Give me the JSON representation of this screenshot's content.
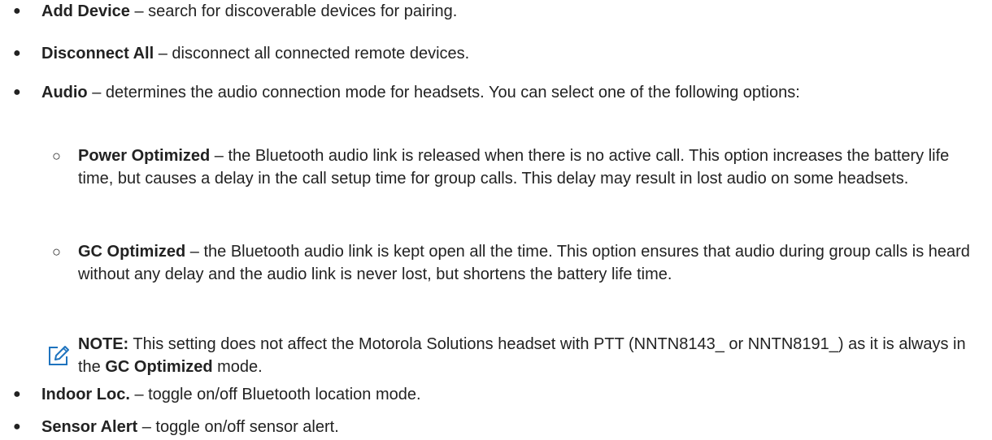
{
  "items": [
    {
      "term": "Add Device",
      "desc": " – search for discoverable devices for pairing."
    },
    {
      "term": "Disconnect All",
      "desc": " – disconnect all connected remote devices."
    },
    {
      "term": "Audio",
      "desc": " – determines the audio connection mode for headsets. You can select one of the following options:"
    },
    {
      "term": "Indoor Loc.",
      "desc": " – toggle on/off Bluetooth location mode."
    },
    {
      "term": "Sensor Alert",
      "desc": " – toggle on/off sensor alert."
    }
  ],
  "subitems": [
    {
      "term": "Power Optimized",
      "desc": " – the Bluetooth audio link is released when there is no active call. This option increases the battery life time, but causes a delay in the call setup time for group calls. This delay may result in lost audio on some headsets."
    },
    {
      "term": "GC Optimized",
      "desc": " – the Bluetooth audio link is kept open all the time. This option ensures that audio during group calls is heard without any delay and the audio link is never lost, but shortens the battery life time."
    }
  ],
  "note": {
    "label": "NOTE:",
    "text_before": " This setting does not affect the Motorola Solutions headset with PTT (NNTN8143_ or NNTN8191_) as it is always in the ",
    "emphasis": "GC Optimized",
    "text_after": " mode."
  },
  "bullet_char": "●",
  "sub_bullet_char": "○",
  "icons": {
    "note": "note-pencil-icon"
  }
}
